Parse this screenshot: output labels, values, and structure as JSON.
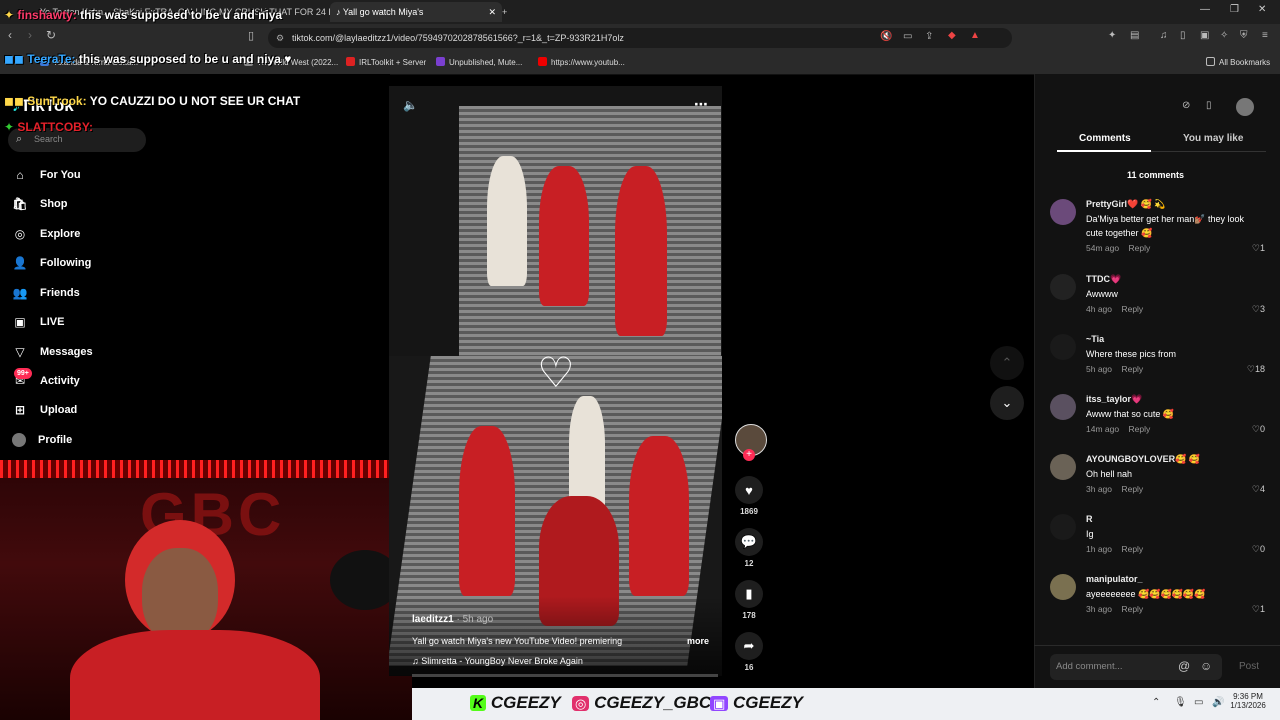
{
  "browser": {
    "tabs": [
      {
        "label": "Yo Tonton Kahn... ShaKai ExTRA (2022..."
      },
      {
        "label": "CALLING MY CRUSH THAT FOR 24 H"
      },
      {
        "label": "Yall go watch Miya's"
      }
    ],
    "url": "tiktok.com/@laylaeditzz1/video/7594970202878561566?_r=1&_t=ZP-933R21H7olz",
    "bookmarks": [
      "Yolanda & Kima Gotta...",
      "The Wild West (2022...",
      "IRLToolkit + Server",
      "Unpublished, Mute...",
      "https://www.youtub..."
    ],
    "all_bookmarks": "All Bookmarks"
  },
  "chat": [
    {
      "user": "finshawty:",
      "message": "this was supposed to be u and niya",
      "color": "#ff3b6b"
    },
    {
      "user": "TeeraTe:",
      "message": "this was supposed to be u and niya ♥",
      "color": "#35a7ff"
    },
    {
      "user": "SunTrook:",
      "message": "YO CAUZZI DO U NOT SEE UR CHAT",
      "color": "#ffd84a"
    },
    {
      "user": "SLATTCOBY:",
      "message": "",
      "color": "#e4212a"
    }
  ],
  "tiktok": {
    "logo": "TikTok",
    "search_placeholder": "Search",
    "nav": [
      {
        "label": "For You",
        "icon": "home-icon"
      },
      {
        "label": "Shop",
        "icon": "shop-icon"
      },
      {
        "label": "Explore",
        "icon": "compass-icon"
      },
      {
        "label": "Following",
        "icon": "following-icon"
      },
      {
        "label": "Friends",
        "icon": "friends-icon"
      },
      {
        "label": "LIVE",
        "icon": "live-icon"
      },
      {
        "label": "Messages",
        "icon": "messages-icon"
      },
      {
        "label": "Activity",
        "icon": "activity-icon",
        "badge": "99+"
      },
      {
        "label": "Upload",
        "icon": "upload-icon"
      },
      {
        "label": "Profile",
        "icon": "profile-icon"
      }
    ]
  },
  "video": {
    "author": "laeditzz1",
    "time": "· 5h ago",
    "caption": "Yall go watch Miya's new YouTube Video! premiering",
    "more": "more",
    "sound": "Slimretta - YoungBoy Never Broke Again"
  },
  "actions": {
    "likes": "1869",
    "comments": "12",
    "saves": "178",
    "shares": "16"
  },
  "comments_panel": {
    "tab_comments": "Comments",
    "tab_you_may_like": "You may like",
    "count": "11 comments",
    "reply": "Reply",
    "add_placeholder": "Add comment...",
    "post": "Post",
    "items": [
      {
        "user": "PrettyGirl❤️ 🥰 💫",
        "text": "Da'Miya better get her man💅🏽 they look cute together 🥰",
        "time": "54m ago",
        "likes": "1",
        "avatar": "#6b4a7a"
      },
      {
        "user": "TTDC💗",
        "text": "Awwww",
        "time": "4h ago",
        "likes": "3",
        "avatar": "#333"
      },
      {
        "user": "~Tia",
        "text": "Where these pics from",
        "time": "5h ago",
        "likes": "18",
        "avatar": "#1a1a1a"
      },
      {
        "user": "itss_taylor💗",
        "text": "Awww that so cute 🥰",
        "time": "14m ago",
        "likes": "0",
        "avatar": "#5a5060"
      },
      {
        "user": "AYOUNGBOYLOVER🥰 🥰",
        "text": "Oh hell nah",
        "time": "3h ago",
        "likes": "4",
        "avatar": "#6a6256"
      },
      {
        "user": "R",
        "text": "Ig",
        "time": "1h ago",
        "likes": "0",
        "avatar": "#1a1a1a"
      },
      {
        "user": "manipulator_",
        "text": "ayeeeeeeee 🥰🥰🥰🥰🥰🥰",
        "time": "3h ago",
        "likes": "1",
        "avatar": "#7a7050"
      }
    ]
  },
  "overlay": {
    "social1": "CGEEZY",
    "social2": "CGEEZY_GBC",
    "social3": "CGEEZY"
  },
  "taskbar": {
    "time": "9:36 PM",
    "date": "1/13/2026"
  }
}
